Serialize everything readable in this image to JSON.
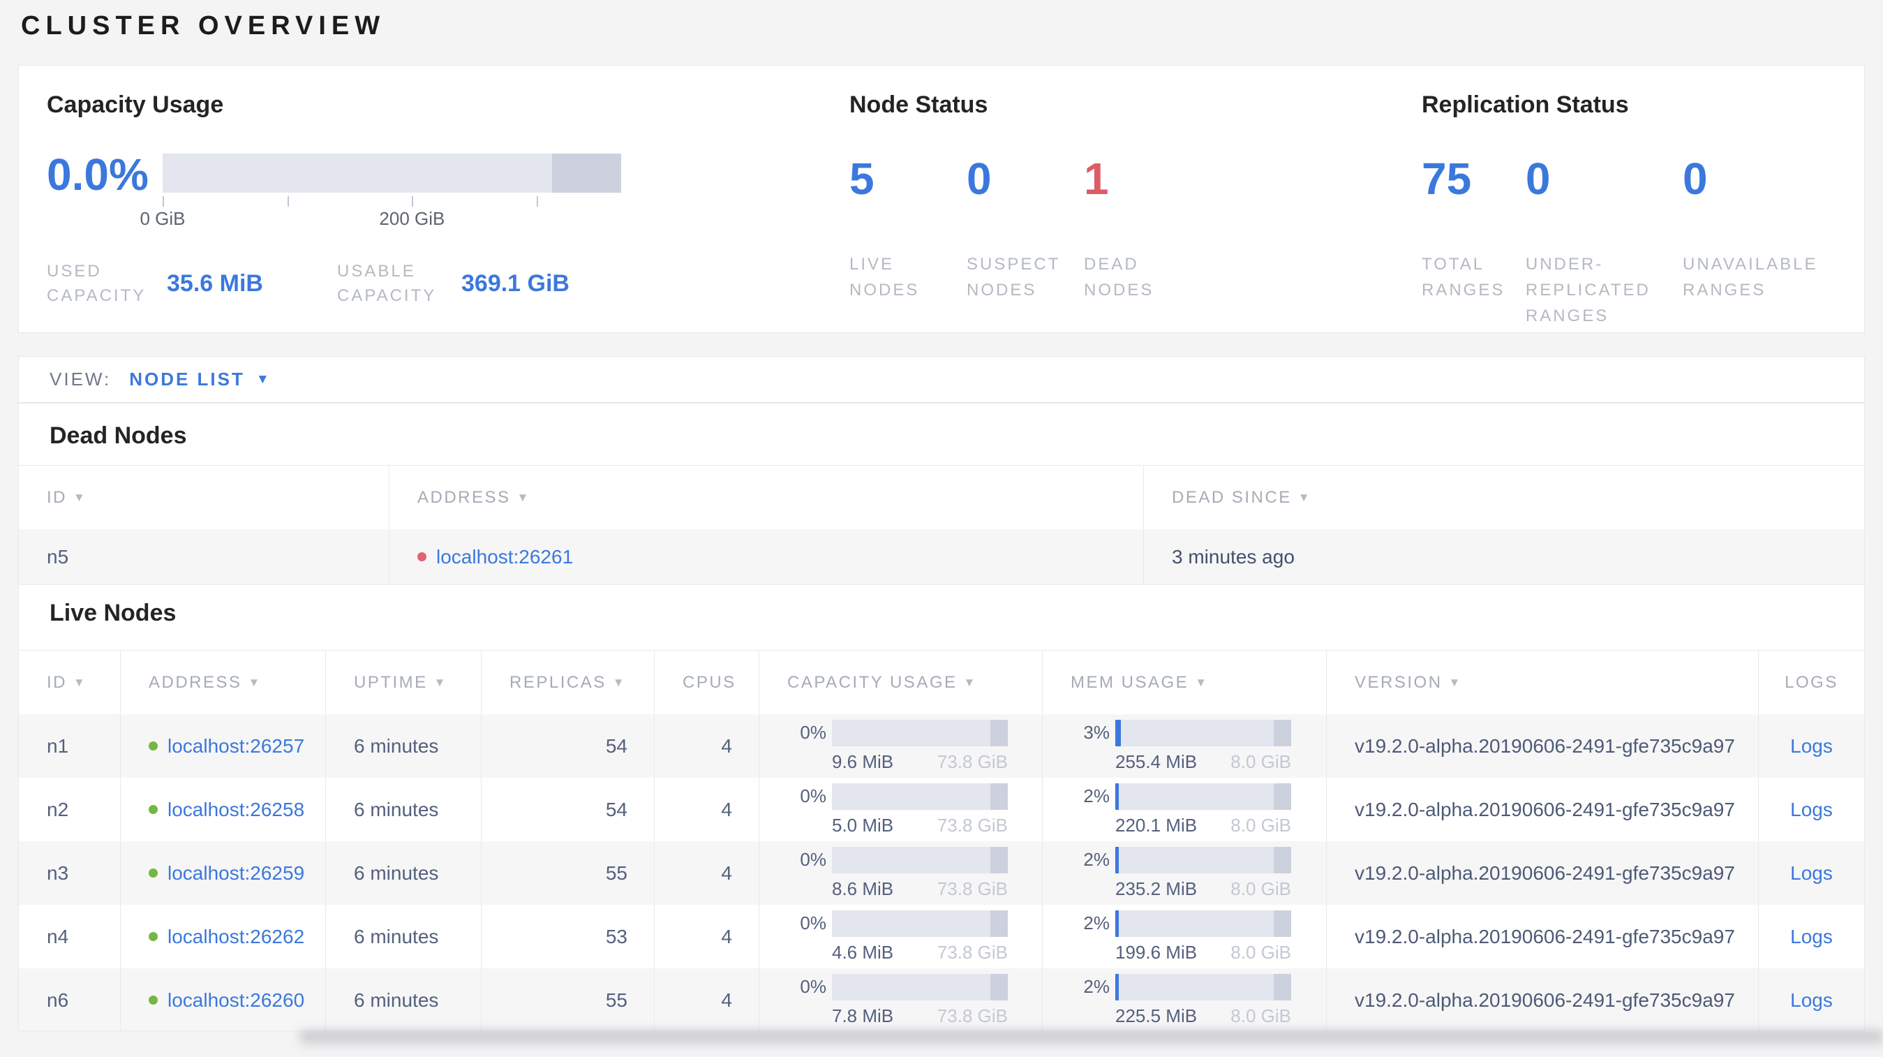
{
  "page_title": "CLUSTER OVERVIEW",
  "icons": {
    "sort_arrow": "▼",
    "dropdown_arrow": "▼"
  },
  "colors": {
    "accent_blue": "#3b78dd",
    "danger_red": "#de5b68",
    "live_dot_green": "#77b545",
    "dead_dot_red": "#e0636e",
    "bar_track": "#e3e6ee",
    "bar_track_dark": "#ccd1dd"
  },
  "summary": {
    "capacity": {
      "title": "Capacity Usage",
      "percent": "0.0%",
      "axis_labels": [
        "0 GiB",
        "200 GiB"
      ],
      "used": {
        "label": "USED CAPACITY",
        "value": "35.6 MiB"
      },
      "usable": {
        "label": "USABLE CAPACITY",
        "value": "369.1 GiB"
      }
    },
    "node_status": {
      "title": "Node Status",
      "stats": [
        {
          "value": "5",
          "label": "LIVE NODES"
        },
        {
          "value": "0",
          "label": "SUSPECT NODES"
        },
        {
          "value": "1",
          "label": "DEAD NODES"
        }
      ]
    },
    "replication": {
      "title": "Replication Status",
      "stats": [
        {
          "value": "75",
          "label": "TOTAL RANGES"
        },
        {
          "value": "0",
          "label": "UNDER-REPLICATED RANGES"
        },
        {
          "value": "0",
          "label": "UNAVAILABLE RANGES"
        }
      ]
    }
  },
  "view_bar": {
    "label": "VIEW:",
    "selected": "NODE LIST"
  },
  "dead_nodes": {
    "title": "Dead Nodes",
    "columns": [
      {
        "label": "ID"
      },
      {
        "label": "ADDRESS"
      },
      {
        "label": "DEAD SINCE"
      }
    ],
    "rows": [
      {
        "id": "n5",
        "address": "localhost:26261",
        "dead_since": "3 minutes ago"
      }
    ]
  },
  "live_nodes": {
    "title": "Live Nodes",
    "columns": [
      {
        "label": "ID"
      },
      {
        "label": "ADDRESS"
      },
      {
        "label": "UPTIME"
      },
      {
        "label": "REPLICAS"
      },
      {
        "label": "CPUS"
      },
      {
        "label": "CAPACITY USAGE"
      },
      {
        "label": "MEM USAGE"
      },
      {
        "label": "VERSION"
      },
      {
        "label": "LOGS"
      }
    ],
    "rows": [
      {
        "id": "n1",
        "address": "localhost:26257",
        "uptime": "6 minutes",
        "replicas": "54",
        "cpus": "4",
        "capacity": {
          "percent": "0%",
          "used": "9.6 MiB",
          "total": "73.8 GiB"
        },
        "mem": {
          "percent": "3%",
          "used": "255.4 MiB",
          "total": "8.0 GiB"
        },
        "version": "v19.2.0-alpha.20190606-2491-gfe735c9a97",
        "logs": "Logs"
      },
      {
        "id": "n2",
        "address": "localhost:26258",
        "uptime": "6 minutes",
        "replicas": "54",
        "cpus": "4",
        "capacity": {
          "percent": "0%",
          "used": "5.0 MiB",
          "total": "73.8 GiB"
        },
        "mem": {
          "percent": "2%",
          "used": "220.1 MiB",
          "total": "8.0 GiB"
        },
        "version": "v19.2.0-alpha.20190606-2491-gfe735c9a97",
        "logs": "Logs"
      },
      {
        "id": "n3",
        "address": "localhost:26259",
        "uptime": "6 minutes",
        "replicas": "55",
        "cpus": "4",
        "capacity": {
          "percent": "0%",
          "used": "8.6 MiB",
          "total": "73.8 GiB"
        },
        "mem": {
          "percent": "2%",
          "used": "235.2 MiB",
          "total": "8.0 GiB"
        },
        "version": "v19.2.0-alpha.20190606-2491-gfe735c9a97",
        "logs": "Logs"
      },
      {
        "id": "n4",
        "address": "localhost:26262",
        "uptime": "6 minutes",
        "replicas": "53",
        "cpus": "4",
        "capacity": {
          "percent": "0%",
          "used": "4.6 MiB",
          "total": "73.8 GiB"
        },
        "mem": {
          "percent": "2%",
          "used": "199.6 MiB",
          "total": "8.0 GiB"
        },
        "version": "v19.2.0-alpha.20190606-2491-gfe735c9a97",
        "logs": "Logs"
      },
      {
        "id": "n6",
        "address": "localhost:26260",
        "uptime": "6 minutes",
        "replicas": "55",
        "cpus": "4",
        "capacity": {
          "percent": "0%",
          "used": "7.8 MiB",
          "total": "73.8 GiB"
        },
        "mem": {
          "percent": "2%",
          "used": "225.5 MiB",
          "total": "8.0 GiB"
        },
        "version": "v19.2.0-alpha.20190606-2491-gfe735c9a97",
        "logs": "Logs"
      }
    ]
  }
}
